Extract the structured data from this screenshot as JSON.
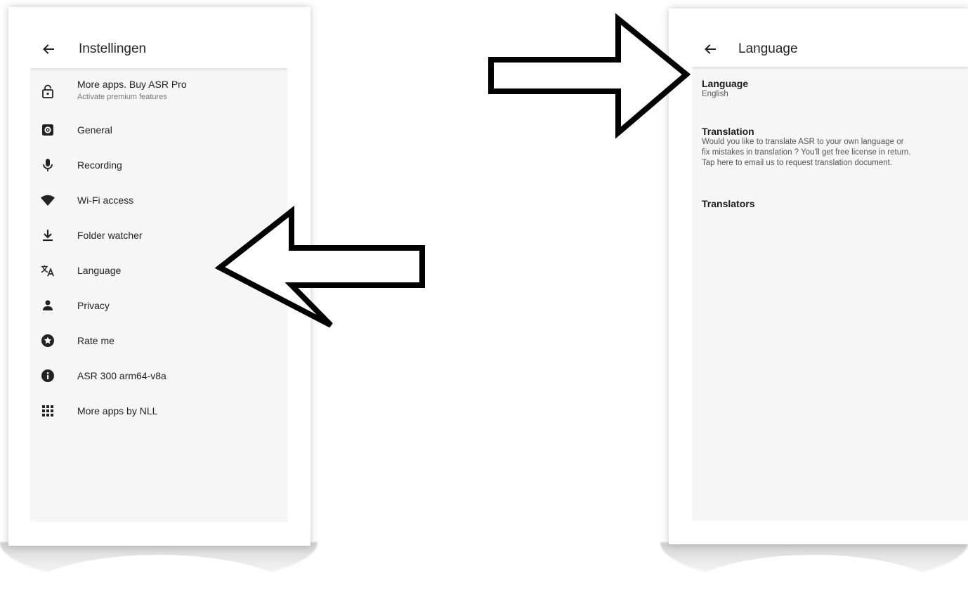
{
  "left_screen": {
    "title": "Instellingen",
    "items": [
      {
        "label": "More apps. Buy ASR Pro",
        "sublabel": "Activate premium features",
        "icon": "lock-icon"
      },
      {
        "label": "General",
        "icon": "settings-square-icon"
      },
      {
        "label": "Recording",
        "icon": "microphone-icon"
      },
      {
        "label": "Wi-Fi access",
        "icon": "wifi-icon"
      },
      {
        "label": "Folder watcher",
        "icon": "download-icon"
      },
      {
        "label": "Language",
        "icon": "translate-icon"
      },
      {
        "label": "Privacy",
        "icon": "person-icon"
      },
      {
        "label": "Rate me",
        "icon": "star-circle-icon"
      },
      {
        "label": "ASR 300 arm64-v8a",
        "icon": "info-icon"
      },
      {
        "label": "More apps by NLL",
        "icon": "apps-grid-icon"
      }
    ]
  },
  "right_screen": {
    "title": "Language",
    "prefs": [
      {
        "title": "Language",
        "summary": [
          "English"
        ]
      },
      {
        "title": "Translation",
        "summary": [
          "Would you like to translate ASR to your own language or",
          "fix mistakes in translation ? You'll get free license in return.",
          "Tap here to email us to request translation document."
        ]
      },
      {
        "title": "Translators",
        "summary": []
      }
    ]
  },
  "colors": {
    "screen_bg": "#f6f6f6",
    "appbar_bg": "#ffffff",
    "icon": "#222222",
    "arrow_stroke": "#000000"
  }
}
